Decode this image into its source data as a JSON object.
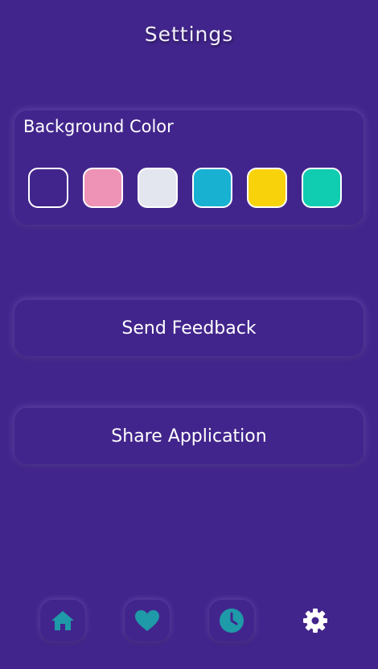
{
  "header": {
    "title": "Settings"
  },
  "background_color": {
    "label": "Background Color",
    "swatches": [
      {
        "name": "purple",
        "color": "#42258c"
      },
      {
        "name": "pink",
        "color": "#ee92b6"
      },
      {
        "name": "light-gray",
        "color": "#e3e6ee"
      },
      {
        "name": "cyan",
        "color": "#18b1d2"
      },
      {
        "name": "yellow",
        "color": "#f8d30b"
      },
      {
        "name": "teal",
        "color": "#10cdb1"
      }
    ]
  },
  "actions": {
    "send_feedback": "Send Feedback",
    "share_application": "Share Application"
  },
  "bottom_nav": {
    "items": [
      {
        "icon": "home-icon",
        "color": "#1f9aa8"
      },
      {
        "icon": "heart-icon",
        "color": "#1f9aa8"
      },
      {
        "icon": "clock-icon",
        "color": "#1f9aa8"
      },
      {
        "icon": "gear-icon",
        "color": "#ffffff"
      }
    ]
  }
}
